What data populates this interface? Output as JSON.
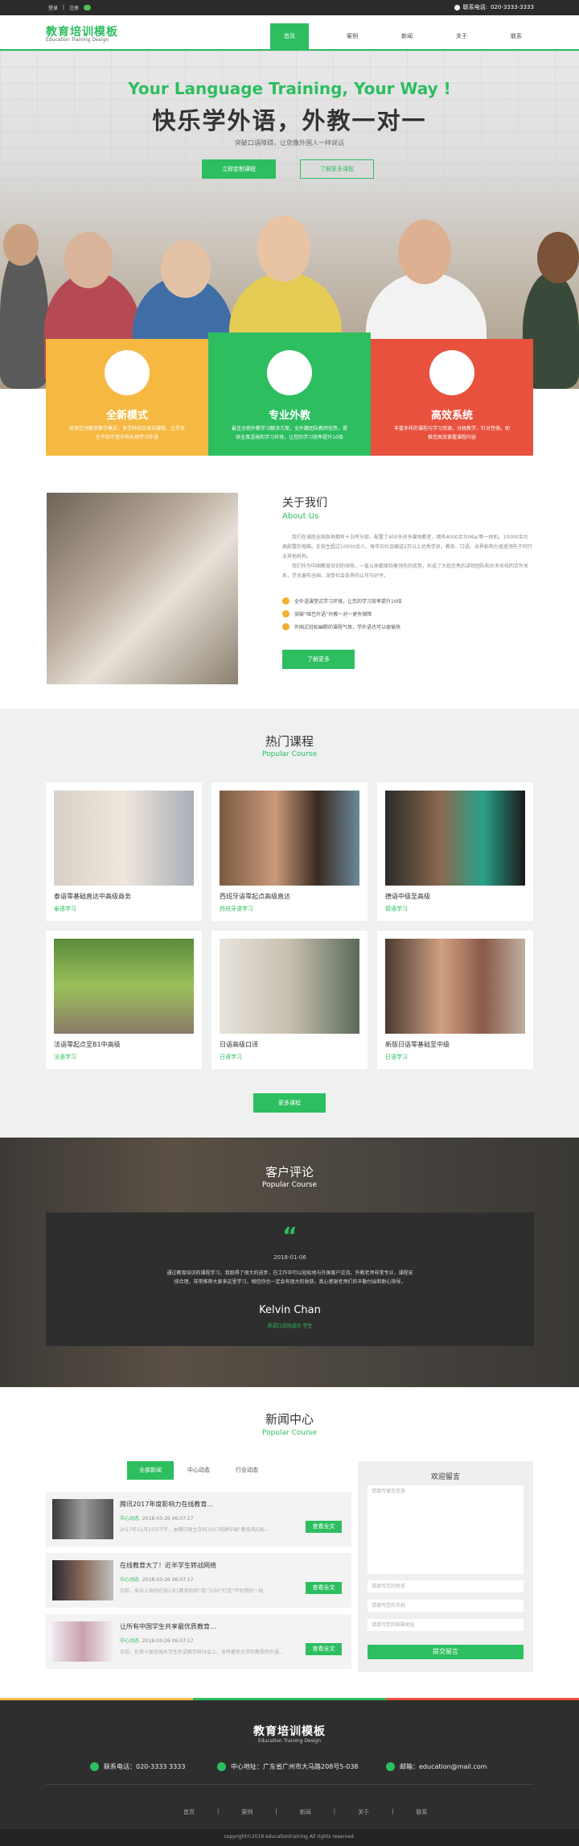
{
  "topbar": {
    "login": "登录",
    "sep": "|",
    "register": "注册",
    "phone_label": "联系电话:",
    "phone": "020-3333-3333"
  },
  "header": {
    "logo_cn": "教育培训模板",
    "logo_en": "Education Training Design"
  },
  "nav": [
    "首页",
    "案例",
    "新闻",
    "关于",
    "联系"
  ],
  "hero": {
    "title_en": "Your Language Training, Your Way !",
    "title_cn": "快乐学外语，外教一对一",
    "subtitle": "突破口语障碍，让您像外国人一样说话",
    "btn_primary": "立即定制课程",
    "btn_secondary": "了解更多课程"
  },
  "features": [
    {
      "title": "全新模式",
      "desc": "采用互动教室教学模式，多学科综合培训课程，让学员在不知不觉中快乐地学习外语",
      "color": "#f5b942"
    },
    {
      "title": "专业外教",
      "desc": "最佳全职外教学习解决方案，全外籍团队教师优势，提供全真语境和学习环境，让您的学习效率提升10倍",
      "color": "#2dbe60"
    },
    {
      "title": "高效系统",
      "desc": "丰富多样的课程与学习资源，分级教学，针对性强，助推您高效掌握课程内容",
      "color": "#e8513e"
    }
  ],
  "about": {
    "title": "关于我们",
    "title_en": "About Us",
    "p1": "我们在湖南全国各地拥有十五所分部，配置了400多间多媒体教室，拥有4000余台iMac等一体机。10000余台高配置的电脑。在校生超过10000余人，每年向社会输送2万以上优秀学员。教练、口语、业界影响力遥遥领先于同行业其他机构。",
    "p2": "我们作为中国教育培训的领导，一直以来都保持着领先的优势，形成了大批优秀的讲师团队和众多名校的合作关系，学员遍布全国，深受社会各界的认可与好评。",
    "checks": [
      "全外语课堂式学习环境，让您的学习效率提升10倍",
      "突破“哑巴外语”外教一对一更有保障",
      "外国式轻松幽默的课程气氛，学外语也可以很愉快"
    ],
    "btn": "了解更多"
  },
  "courses": {
    "title": "热门课程",
    "title_en": "Popular Course",
    "items": [
      {
        "name": "泰语零基础直达中高级商务",
        "cat": "泰语学习"
      },
      {
        "name": "西班牙语零起点高级直达",
        "cat": "西班牙语学习"
      },
      {
        "name": "德语中级至高级",
        "cat": "德语学习"
      },
      {
        "name": "法语零起点至B1中高级",
        "cat": "法语学习"
      },
      {
        "name": "日语高级口译",
        "cat": "日语学习"
      },
      {
        "name": "新版日语零基础至中级",
        "cat": "日语学习"
      }
    ],
    "btn": "更多课程"
  },
  "reviews": {
    "title": "客户评论",
    "title_en": "Popular Course",
    "date": "2018-01-06",
    "text": "通过教育培训的课程学习，我取得了很大的进步，在工作中可以轻松地与外国客户交流，外教老师非常专业，课程安排合理，非常推荐大家来这里学习，相信你也一定会有很大的收获，真心感谢老师们的辛勤付出和耐心指导。",
    "name": "Kelvin Chan",
    "role": "英语口语班成员 学生"
  },
  "news": {
    "title": "新闻中心",
    "title_en": "Popular Course",
    "tabs": [
      "全部新闻",
      "中心动态",
      "行业动态"
    ],
    "items": [
      {
        "title": "腾讯2017年度影响力在线教育...",
        "cat": "中心动态",
        "date": "2018-03-26 06:07:17",
        "desc": "2017年11月22日下午，由腾讯网主办的2017回顾中国“教育风向标...",
        "btn": "查看全文"
      },
      {
        "title": "在线教育大了！近半学生转战网络",
        "cat": "中心动态",
        "date": "2018-03-26 06:07:17",
        "desc": "日前，来自上海的在线1对1教育机构“厚门100”打造“不好用的一线...",
        "btn": "查看全文"
      },
      {
        "title": "让所有中国学生共享最优质教育...",
        "cat": "中心动态",
        "date": "2018-03-26 06:07:17",
        "desc": "日前，在第十届全国大学生外语教学研讨会上，多所著名大学的教授和外语...",
        "btn": "查看全文"
      }
    ],
    "form": {
      "title": "欢迎留言",
      "msg_ph": "请填写留言信息",
      "name_ph": "请填写您的姓名",
      "phone_ph": "请填写您的手机",
      "email_ph": "请填写您的邮箱地址",
      "submit": "提交留言"
    }
  },
  "footer": {
    "logo_cn": "教育培训模板",
    "logo_en": "Education Training Design",
    "phone": "联系电话：020-3333 3333",
    "address": "中心地址：广东省广州市大马路208号5-038",
    "email": "邮箱：education@mail.com",
    "nav": [
      "首页",
      "案例",
      "新闻",
      "关于",
      "联系"
    ],
    "copyright": "copyright©2018 educationtraining All rights reserved."
  },
  "colors": {
    "accent": "#2dbe60",
    "yellow": "#f5b942",
    "red": "#e8513e",
    "dark": "#2e2e2e"
  }
}
